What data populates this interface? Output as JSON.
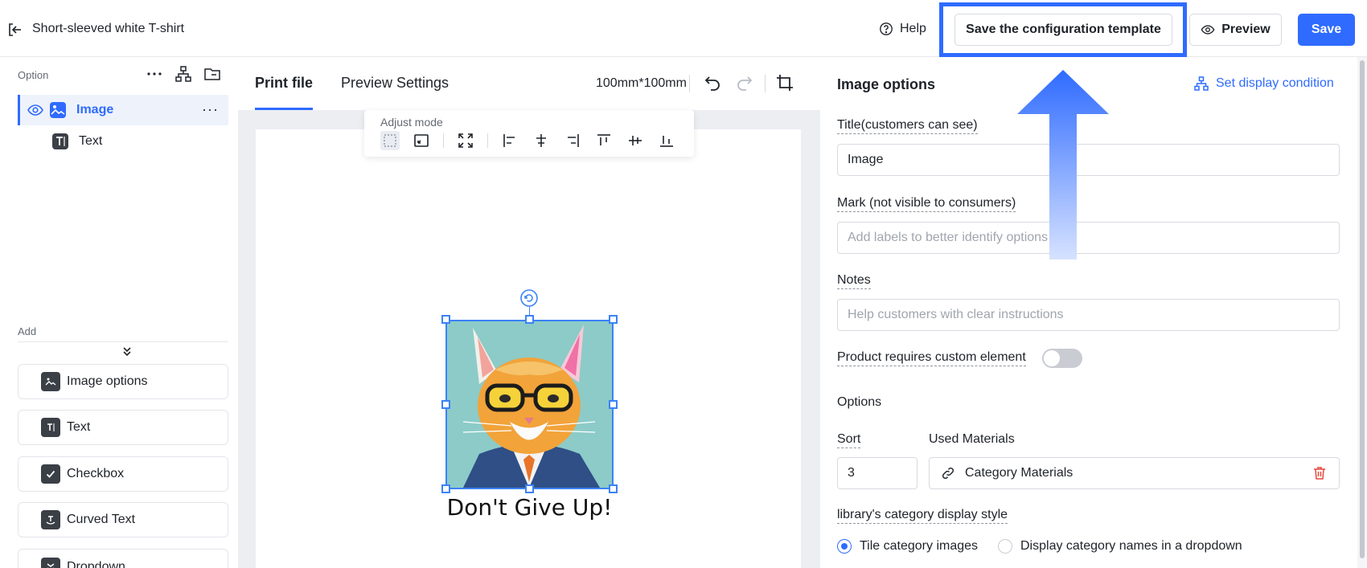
{
  "topbar": {
    "product_title": "Short-sleeved white T-shirt",
    "help_label": "Help",
    "save_template_label": "Save the configuration template",
    "preview_label": "Preview",
    "save_label": "Save"
  },
  "left": {
    "option_section_label": "Option",
    "layers": [
      {
        "label": "Image",
        "active": true
      },
      {
        "label": "Text",
        "active": false
      }
    ],
    "add_section_label": "Add",
    "add_items": [
      {
        "label": "Image options",
        "icon": "image-icon"
      },
      {
        "label": "Text",
        "icon": "text-icon"
      },
      {
        "label": "Checkbox",
        "icon": "checkbox-icon"
      },
      {
        "label": "Curved Text",
        "icon": "curved-text-icon"
      },
      {
        "label": "Dropdown",
        "icon": "dropdown-icon"
      }
    ]
  },
  "canvas": {
    "tabs": [
      {
        "label": "Print file",
        "active": true
      },
      {
        "label": "Preview Settings",
        "active": false
      }
    ],
    "dimensions": "100mm*100mm",
    "adjust_mode_label": "Adjust mode",
    "design_caption": "Don't Give Up!"
  },
  "right": {
    "title": "Image options",
    "set_condition_label": "Set display condition",
    "title_field": {
      "label": "Title(customers can see)",
      "value": "Image"
    },
    "mark_field": {
      "label": "Mark (not visible to consumers)",
      "placeholder": "Add labels to better identify options"
    },
    "notes_field": {
      "label": "Notes",
      "placeholder": "Help customers with clear instructions"
    },
    "custom_element": {
      "label": "Product requires custom element",
      "enabled": false
    },
    "options_heading": "Options",
    "sort": {
      "label": "Sort",
      "value": "3"
    },
    "used_materials": {
      "label": "Used Materials",
      "value": "Category Materials"
    },
    "display_style": {
      "label": "library's category display style",
      "choices": [
        {
          "label": "Tile category images",
          "selected": true
        },
        {
          "label": "Display category names in a dropdown",
          "selected": false
        }
      ]
    }
  },
  "colors": {
    "accent": "#2f6bff",
    "highlight": "#2f6bff",
    "danger": "#e5483b"
  }
}
